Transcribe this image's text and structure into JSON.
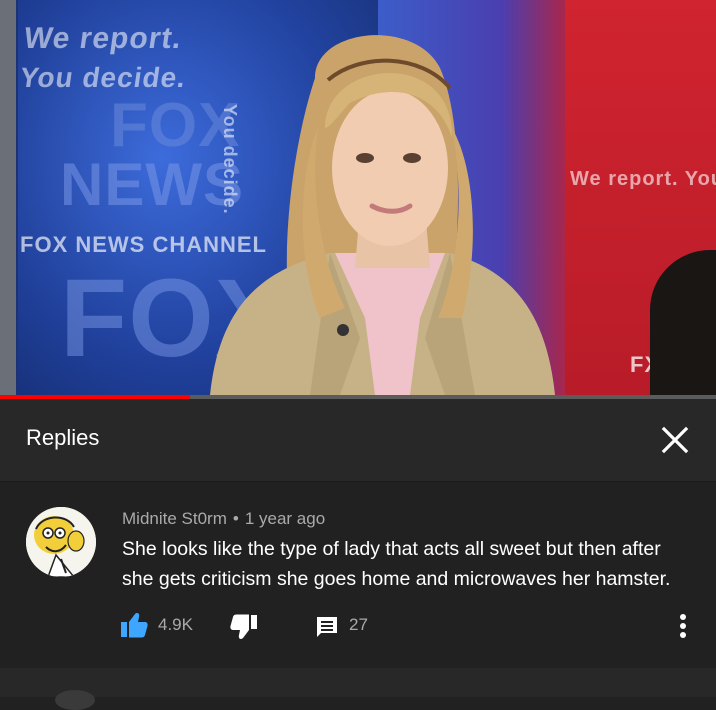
{
  "video": {
    "bg_text": [
      "We report.",
      "You decide.",
      "NEWS",
      "FOX",
      "FOX NEWS CHANNEL",
      "You decide.",
      "We report.",
      "FOX",
      "We report. You d",
      "FX"
    ],
    "progress": 0.265
  },
  "replies_panel": {
    "title": "Replies",
    "close_icon": "close-icon"
  },
  "comment": {
    "author": "Midnite St0rm",
    "separator": "•",
    "time": "1 year ago",
    "text": "She looks like the type of lady that acts all sweet but then after she gets criticism she goes home and microwaves her hamster.",
    "likes": "4.9K",
    "replies": "27",
    "icons": {
      "like": "thumbs-up-icon",
      "dislike": "thumbs-down-icon",
      "reply": "comment-icon",
      "more": "more-vert-icon"
    },
    "accent": "#3ea6ff"
  }
}
